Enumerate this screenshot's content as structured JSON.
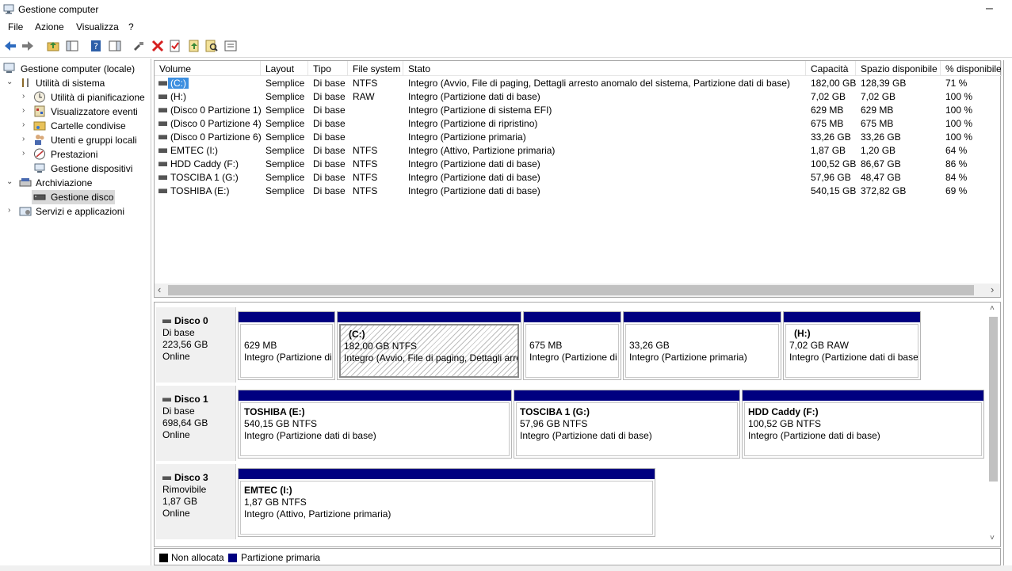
{
  "window": {
    "title": "Gestione computer"
  },
  "menu": [
    "File",
    "Azione",
    "Visualizza",
    "?"
  ],
  "tree": {
    "root": "Gestione computer (locale)",
    "system_tools": "Utilità di sistema",
    "task_scheduler": "Utilità di pianificazione",
    "event_viewer": "Visualizzatore eventi",
    "shared_folders": "Cartelle condivise",
    "local_users": "Utenti e gruppi locali",
    "performance": "Prestazioni",
    "device_manager": "Gestione dispositivi",
    "storage": "Archiviazione",
    "disk_management": "Gestione disco",
    "services": "Servizi e applicazioni"
  },
  "columns": [
    "Volume",
    "Layout",
    "Tipo",
    "File system",
    "Stato",
    "Capacità",
    "Spazio disponibile",
    "% disponibile"
  ],
  "volumes": [
    {
      "volume": "(C:)",
      "layout": "Semplice",
      "tipo": "Di base",
      "fs": "NTFS",
      "stato": "Integro (Avvio, File di paging, Dettagli arresto anomalo del sistema, Partizione dati di base)",
      "capacita": "182,00 GB",
      "spazio": "128,39 GB",
      "perc": "71 %"
    },
    {
      "volume": "(H:)",
      "layout": "Semplice",
      "tipo": "Di base",
      "fs": "RAW",
      "stato": "Integro (Partizione dati di base)",
      "capacita": "7,02 GB",
      "spazio": "7,02 GB",
      "perc": "100 %"
    },
    {
      "volume": "(Disco 0 Partizione 1)",
      "layout": "Semplice",
      "tipo": "Di base",
      "fs": "",
      "stato": "Integro (Partizione di sistema EFI)",
      "capacita": "629 MB",
      "spazio": "629 MB",
      "perc": "100 %"
    },
    {
      "volume": "(Disco 0 Partizione 4)",
      "layout": "Semplice",
      "tipo": "Di base",
      "fs": "",
      "stato": "Integro (Partizione di ripristino)",
      "capacita": "675 MB",
      "spazio": "675 MB",
      "perc": "100 %"
    },
    {
      "volume": "(Disco 0 Partizione 6)",
      "layout": "Semplice",
      "tipo": "Di base",
      "fs": "",
      "stato": "Integro (Partizione primaria)",
      "capacita": "33,26 GB",
      "spazio": "33,26 GB",
      "perc": "100 %"
    },
    {
      "volume": "EMTEC (I:)",
      "layout": "Semplice",
      "tipo": "Di base",
      "fs": "NTFS",
      "stato": "Integro (Attivo, Partizione primaria)",
      "capacita": "1,87 GB",
      "spazio": "1,20 GB",
      "perc": "64 %"
    },
    {
      "volume": "HDD Caddy (F:)",
      "layout": "Semplice",
      "tipo": "Di base",
      "fs": "NTFS",
      "stato": "Integro (Partizione dati di base)",
      "capacita": "100,52 GB",
      "spazio": "86,67 GB",
      "perc": "86 %"
    },
    {
      "volume": "TOSCIBA 1 (G:)",
      "layout": "Semplice",
      "tipo": "Di base",
      "fs": "NTFS",
      "stato": "Integro (Partizione dati di base)",
      "capacita": "57,96 GB",
      "spazio": "48,47 GB",
      "perc": "84 %"
    },
    {
      "volume": "TOSHIBA (E:)",
      "layout": "Semplice",
      "tipo": "Di base",
      "fs": "NTFS",
      "stato": "Integro (Partizione dati di base)",
      "capacita": "540,15 GB",
      "spazio": "372,82 GB",
      "perc": "69 %"
    }
  ],
  "disks": [
    {
      "name": "Disco 0",
      "type": "Di base",
      "size": "223,56 GB",
      "status": "Online",
      "partitions": [
        {
          "name": "",
          "size": "629 MB",
          "status": "Integro (Partizione di"
        },
        {
          "name": "(C:)",
          "size": "182,00 GB NTFS",
          "status": "Integro (Avvio, File di paging, Dettagli arre"
        },
        {
          "name": "",
          "size": "675 MB",
          "status": "Integro (Partizione di"
        },
        {
          "name": "",
          "size": "33,26 GB",
          "status": "Integro (Partizione primaria)"
        },
        {
          "name": "(H:)",
          "size": "7,02 GB RAW",
          "status": "Integro (Partizione dati di base"
        }
      ]
    },
    {
      "name": "Disco 1",
      "type": "Di base",
      "size": "698,64 GB",
      "status": "Online",
      "partitions": [
        {
          "name": "TOSHIBA  (E:)",
          "size": "540,15 GB NTFS",
          "status": "Integro (Partizione dati di base)"
        },
        {
          "name": "TOSCIBA 1  (G:)",
          "size": "57,96 GB NTFS",
          "status": "Integro (Partizione dati di base)"
        },
        {
          "name": "HDD Caddy  (F:)",
          "size": "100,52 GB NTFS",
          "status": "Integro (Partizione dati di base)"
        }
      ]
    },
    {
      "name": "Disco 3",
      "type": "Rimovibile",
      "size": "1,87 GB",
      "status": "Online",
      "partitions": [
        {
          "name": "EMTEC  (I:)",
          "size": "1,87 GB NTFS",
          "status": "Integro (Attivo, Partizione primaria)"
        }
      ]
    }
  ],
  "legend": {
    "unallocated": "Non allocata",
    "primary": "Partizione primaria"
  },
  "colors": {
    "primary_partition": "#000080",
    "unallocated": "#000000",
    "selection": "#3d8fe0"
  },
  "icons": [
    "back-arrow-icon",
    "forward-arrow-icon",
    "up-folder-icon",
    "console-tree-icon",
    "help-icon",
    "action-pane-icon",
    "connect-icon",
    "delete-icon",
    "properties-icon",
    "export-icon",
    "search-icon",
    "list-icon"
  ]
}
